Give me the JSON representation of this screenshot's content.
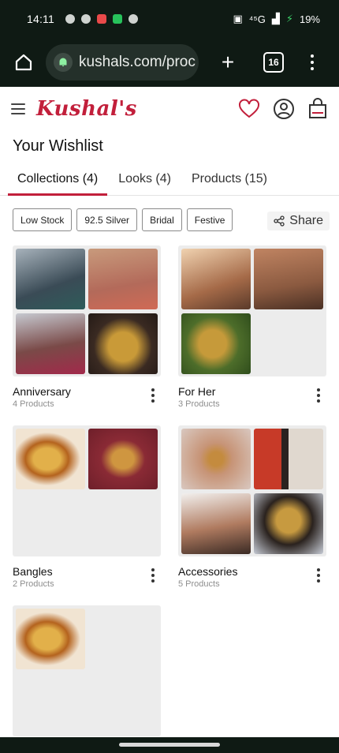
{
  "status": {
    "time": "14:11",
    "signal": "⁴⁵G",
    "battery": "19%"
  },
  "browser": {
    "url": "kushals.com/proc",
    "tab_count": "16"
  },
  "brand": {
    "logo_text": "Kushal's",
    "accent": "#c21f3b"
  },
  "page": {
    "title": "Your Wishlist"
  },
  "tabs": [
    {
      "label": "Collections (4)",
      "active": true
    },
    {
      "label": "Looks (4)",
      "active": false
    },
    {
      "label": "Products (15)",
      "active": false
    }
  ],
  "filters": [
    "Low Stock",
    "92.5 Silver",
    "Bridal",
    "Festive"
  ],
  "share_label": "Share",
  "collections": [
    {
      "title": "Anniversary",
      "count": "4 Products"
    },
    {
      "title": "For Her",
      "count": "3 Products"
    },
    {
      "title": "Bangles",
      "count": "2 Products"
    },
    {
      "title": "Accessories",
      "count": "5 Products"
    },
    {
      "title": "",
      "count": ""
    }
  ]
}
